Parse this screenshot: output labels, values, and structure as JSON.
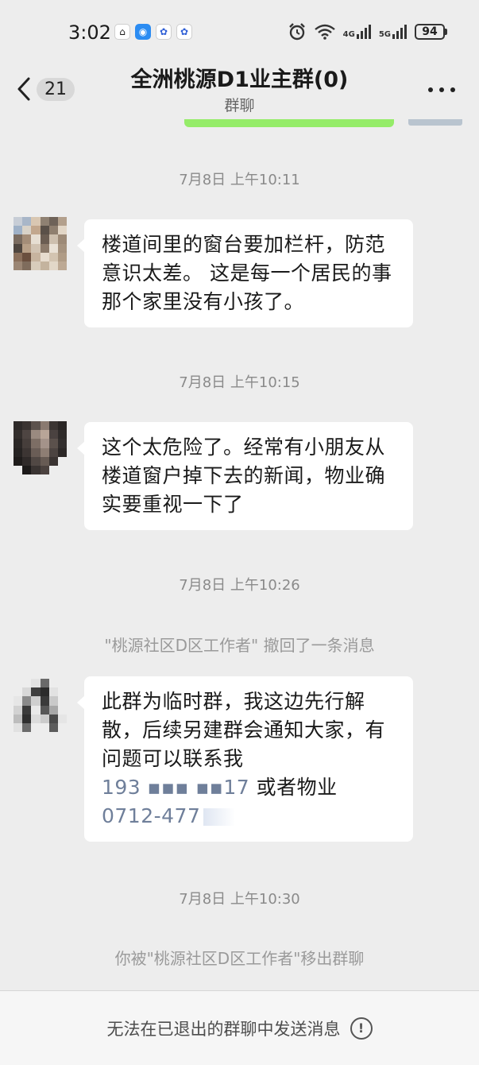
{
  "status_bar": {
    "time": "3:02",
    "signal1": "4G",
    "signal2": "5G",
    "battery": "94",
    "icons": [
      "home-app-icon",
      "chat-app-icon",
      "paw-app-icon",
      "paw-app-icon",
      "alarm-icon",
      "wifi-icon",
      "signal-4g-icon",
      "signal-5g-icon",
      "battery-icon"
    ]
  },
  "nav": {
    "unread_count": "21",
    "title": "全洲桃源D1业主群(0)",
    "subtitle": "群聊"
  },
  "messages": [
    {
      "timestamp": "7月8日 上午10:11",
      "text": "楼道间里的窗台要加栏杆，防范意识太差。 这是每一个居民的事  那个家里没有小孩了。"
    },
    {
      "timestamp": "7月8日 上午10:15",
      "text": "这个太危险了。经常有小朋友从楼道窗户掉下去的新闻，物业确实要重视一下了"
    },
    {
      "timestamp": "7月8日 上午10:26",
      "recall_notice": "\"桃源社区D区工作者\" 撤回了一条消息"
    },
    {
      "text_lines": [
        "此群为临时群，我这边先行解散，后续另建群会通知大家，有问题可以联系我"
      ],
      "phone": "193 ▪▪▪ ▪▪17",
      "phone_suffix": "或者物业",
      "landline": "0712-477"
    },
    {
      "timestamp": "7月8日 上午10:30",
      "removed_notice": "你被\"桃源社区D区工作者\"移出群聊"
    }
  ],
  "bottom_bar": {
    "text": "无法在已退出的群聊中发送消息"
  },
  "colors": {
    "background": "#ededed",
    "bubble": "#ffffff",
    "sent_bubble": "#95ec69",
    "link": "#6f7f9a"
  }
}
